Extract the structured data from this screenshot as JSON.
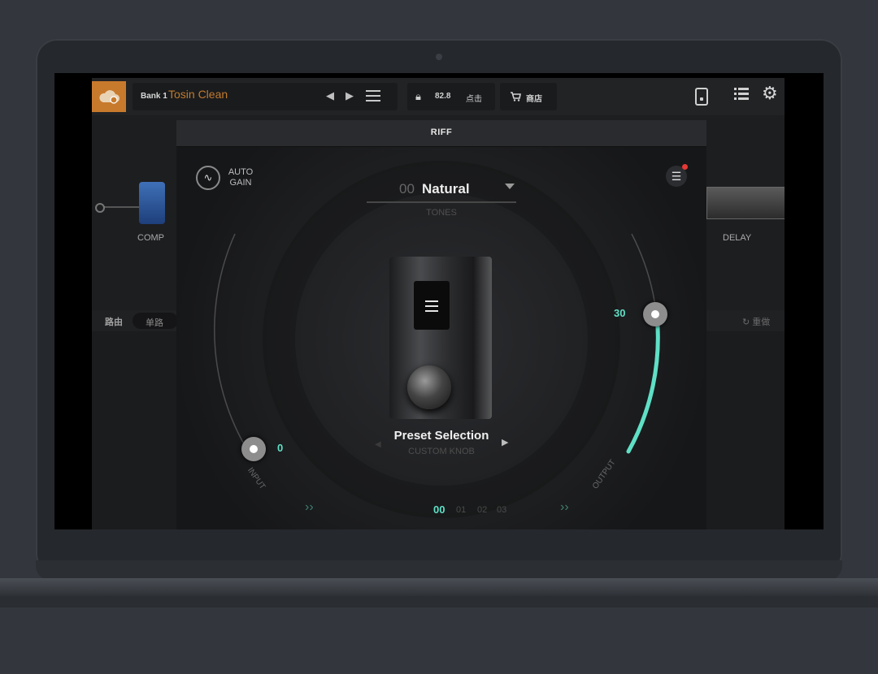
{
  "topbar": {
    "bank_label": "Bank 1",
    "preset_name": "Tosin Clean",
    "prev_symbol": "◀",
    "next_symbol": "▶",
    "bpm": "82.8",
    "tap_label": "点击",
    "shop_label": "商店"
  },
  "chain": {
    "comp_label": "COMP",
    "delay_label": "DELAY",
    "route_label": "路由",
    "route_mode": "单路",
    "redo_label": "↻ 重做"
  },
  "modal": {
    "title": "RIFF",
    "auto_gain_label": "AUTO\nGAIN",
    "tone_number": "00",
    "tone_name": "Natural",
    "tones_label": "TONES",
    "preset_selection_label": "Preset Selection",
    "custom_knob_label": "CUSTOM KNOB",
    "input_value": "0",
    "input_label": "INPUT",
    "output_value": "30",
    "output_label": "OUTPUT",
    "pages": [
      "00",
      "01",
      "02",
      "03"
    ],
    "output_level_fraction": 0.3
  },
  "colors": {
    "accent": "#5fe0c6",
    "brand_orange": "#c87a2c",
    "notify": "#e53935"
  },
  "icons": {
    "cloud": "cloud-icon",
    "lock": "lock-icon",
    "cart": "cart-icon",
    "device": "device-icon",
    "list": "list-icon",
    "gear": "gear-icon",
    "settings": "sliders-icon",
    "auto_gain": "waveform-hand-icon"
  }
}
